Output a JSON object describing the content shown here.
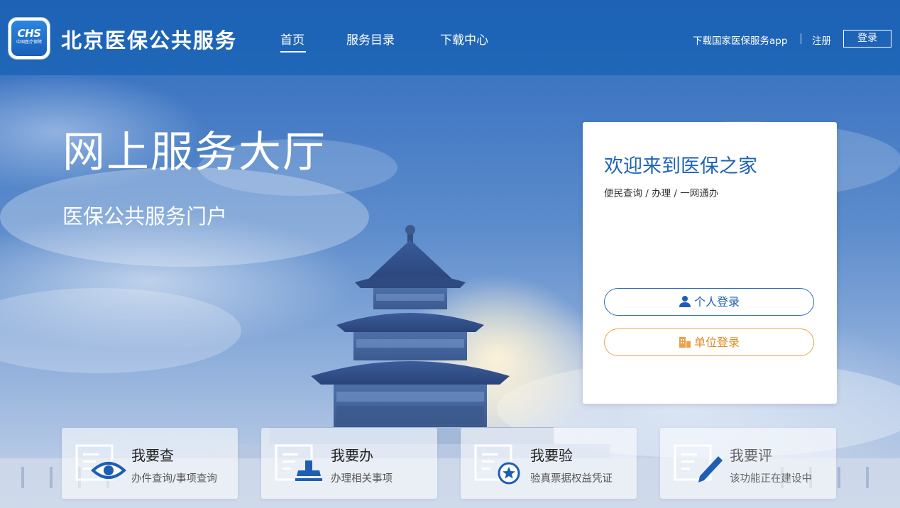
{
  "header": {
    "logo_text": "CHS",
    "logo_subtext": "中国医疗保障",
    "site_title": "北京医保公共服务",
    "nav": [
      {
        "label": "首页",
        "active": true
      },
      {
        "label": "服务目录",
        "active": false
      },
      {
        "label": "下载中心",
        "active": false
      }
    ],
    "download_app": "下载国家医保服务app",
    "register": "注册",
    "login": "登录"
  },
  "hero": {
    "title": "网上服务大厅",
    "subtitle": "医保公共服务门户"
  },
  "welcome_card": {
    "title": "欢迎来到医保之家",
    "subtitle": "便民查询 / 办理 / 一网通办",
    "personal_login": "个人登录",
    "unit_login": "单位登录"
  },
  "tiles": [
    {
      "title": "我要查",
      "desc": "办件查询/事项查询",
      "icon": "eye-document-icon"
    },
    {
      "title": "我要办",
      "desc": "办理相关事项",
      "icon": "stamp-document-icon"
    },
    {
      "title": "我要验",
      "desc": "验真票据权益凭证",
      "icon": "badge-document-icon"
    },
    {
      "title": "我要评",
      "desc": "该功能正在建设中",
      "icon": "pen-document-icon"
    }
  ],
  "colors": {
    "header_bg": "#1d62b5",
    "primary_blue": "#1e63b8",
    "unit_orange": "#e9a14a"
  }
}
